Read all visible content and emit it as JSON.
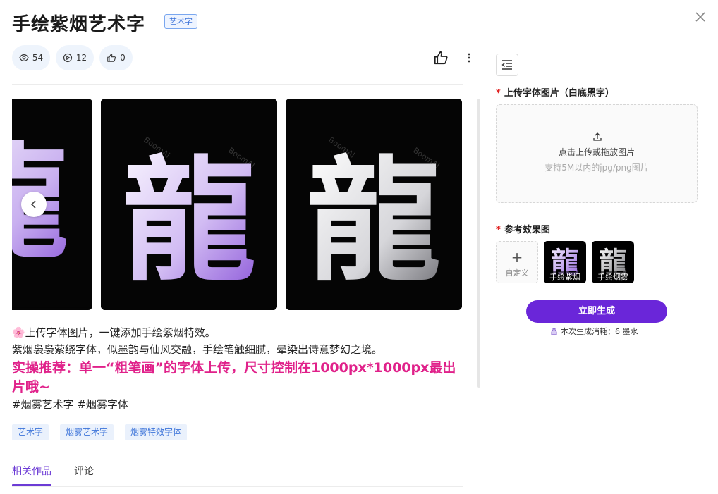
{
  "header": {
    "title": "手绘紫烟艺术字",
    "category_tag": "艺术字",
    "close_icon": "close-icon"
  },
  "stats": {
    "views": "54",
    "plays": "12",
    "likes": "0"
  },
  "gallery": {
    "glyph": "龍",
    "watermark": "BoomAI",
    "colors": {
      "background": "#050505",
      "purple": "#a57ae6",
      "silver": "#e8e8ea"
    }
  },
  "description": {
    "line1": "🌸上传字体图片，一键添加手绘紫烟特效。",
    "line2": "紫烟袅袅萦绕字体，似墨韵与仙风交融，手绘笔触细腻，晕染出诗意梦幻之境。",
    "highlight": "实操推荐：单一“粗笔画”的字体上传，尺寸控制在1000px*1000px最出片哦~",
    "hashtags": "#烟雾艺术字 #烟雾字体"
  },
  "tags": [
    "艺术字",
    "烟雾艺术字",
    "烟雾特效字体"
  ],
  "tabs": {
    "related": "相关作品",
    "comments": "评论"
  },
  "panel": {
    "upload_label": "上传字体图片（白底黑字）",
    "upload_text": "点击上传或拖放图片",
    "upload_hint": "支持5M以内的jpg/png图片",
    "ref_label": "参考效果图",
    "custom_label": "自定义",
    "refs": [
      "手绘紫烟",
      "手绘烟雾"
    ],
    "generate_label": "立即生成",
    "cost_text": "本次生成消耗：6 墨水"
  },
  "colors": {
    "accent": "#6a26d9",
    "highlight": "#e0218a",
    "tag_text": "#3d74d9",
    "stat_bg": "#eef4fc"
  }
}
